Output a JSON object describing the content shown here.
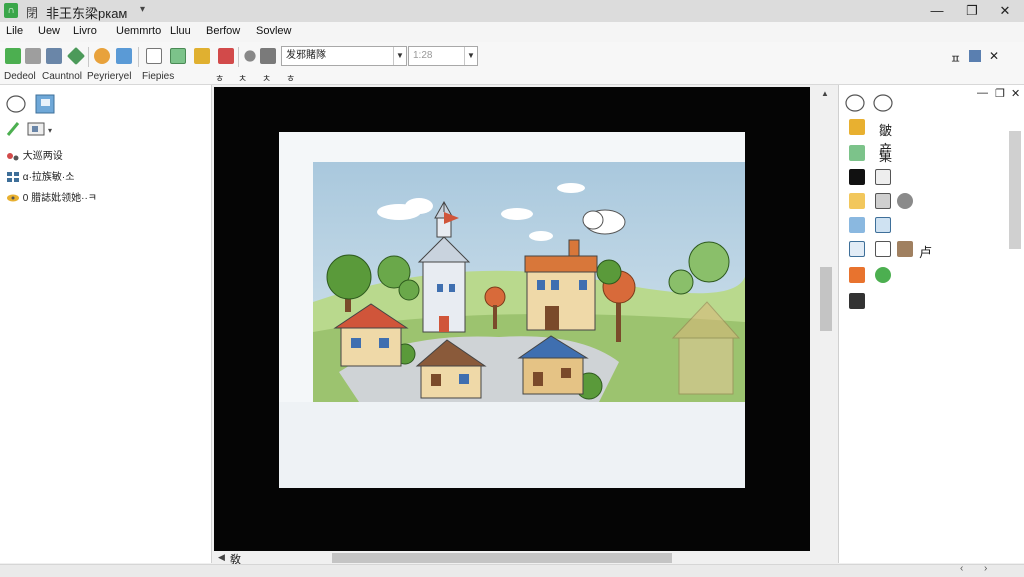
{
  "window": {
    "title": "非王东梁ркам",
    "quick_access": "閉",
    "minimize": "—",
    "restore": "❐",
    "close": "✕"
  },
  "menu": [
    "Lile",
    "Uew",
    "Livro",
    "Uemmrto",
    "Lluu",
    "Berfow",
    "Sovlew"
  ],
  "toolbar": {
    "combo1_value": "发邪賭隊",
    "combo2_value": "1:28",
    "labels": [
      "Dedeol",
      "Cauntnol",
      "Peyrieryel",
      "Fiepies"
    ],
    "markers": [
      "ㅎ",
      "ㅊ",
      "ㅊ",
      "ㅎ"
    ],
    "pin": "ㅍ",
    "close": "✕"
  },
  "left_panel": {
    "items": [
      "大巡两设",
      "α·拉族敏·소",
      "0 腊誌妣领她··ㅋ"
    ]
  },
  "right_panel": {
    "pin": "—",
    "restore": "❐",
    "close": "✕",
    "items": [
      "皺产",
      "菓",
      "",
      "",
      "",
      "",
      "卢",
      "",
      ""
    ]
  },
  "hscroll": {
    "label": "敎"
  },
  "colors": {
    "canvas_bg": "#050505",
    "sky": "#b9d4e4",
    "grass": "#9cc36f",
    "roof_red": "#d0553a",
    "roof_blue": "#3f6fb0",
    "wall_cream": "#efd9a8",
    "wall_tan": "#e5c385"
  }
}
